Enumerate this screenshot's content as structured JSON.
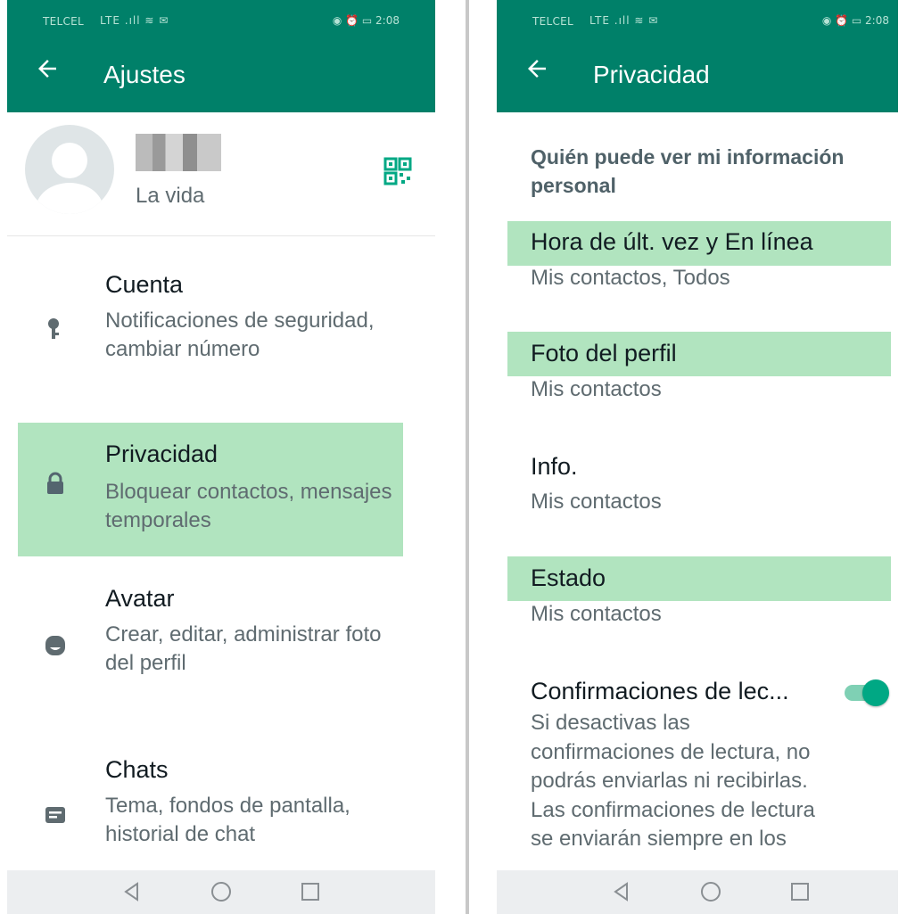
{
  "status_bar": {
    "carrier": "TELCEL",
    "network_icons": "LTE .ıll ≋ ✉",
    "time": "2:08"
  },
  "left": {
    "title": "Ajustes",
    "profile": {
      "about": "La vida"
    },
    "items": [
      {
        "title": "Cuenta",
        "subtitle": "Notificaciones de seguridad, cambiar número",
        "icon": "key-icon"
      },
      {
        "title": "Privacidad",
        "subtitle": "Bloquear contactos, mensajes temporales",
        "icon": "lock-icon"
      },
      {
        "title": "Avatar",
        "subtitle": "Crear, editar, administrar foto del perfil",
        "icon": "avatar-icon"
      },
      {
        "title": "Chats",
        "subtitle": "Tema, fondos de pantalla, historial de chat",
        "icon": "chat-icon"
      }
    ]
  },
  "right": {
    "title": "Privacidad",
    "section_header": "Quién puede ver mi información personal",
    "items": [
      {
        "title": "Hora de últ. vez y En línea",
        "subtitle": "Mis contactos, Todos"
      },
      {
        "title": "Foto del perfil",
        "subtitle": "Mis contactos"
      },
      {
        "title": "Info.",
        "subtitle": "Mis contactos"
      },
      {
        "title": "Estado",
        "subtitle": "Mis contactos"
      }
    ],
    "read_receipts": {
      "title": "Confirmaciones de lec...",
      "description": "Si desactivas las confirmaciones de lectura, no podrás enviarlas ni recibirlas. Las confirmaciones de lectura se enviarán siempre en los",
      "enabled": true
    }
  },
  "colors": {
    "app_bar": "#008069",
    "highlight": "#b1e4bf",
    "accent": "#00a884",
    "text_primary": "#111b21",
    "text_secondary": "#5f6b70"
  }
}
